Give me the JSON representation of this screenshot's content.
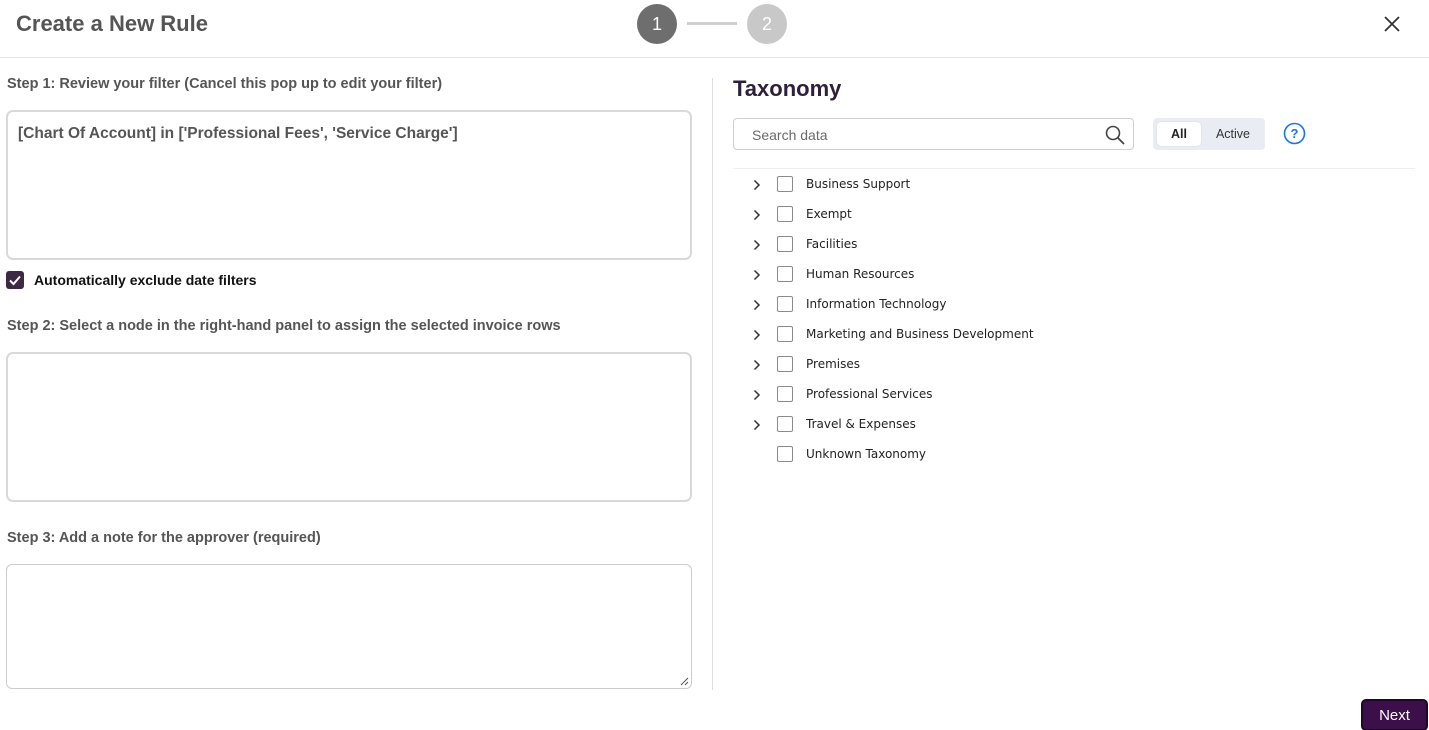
{
  "header": {
    "title": "Create a New Rule",
    "steps": [
      "1",
      "2"
    ],
    "current_step": 1
  },
  "step1": {
    "label": "Step 1: Review your filter (Cancel this pop up to edit your filter)",
    "filter_text": "[Chart Of Account] in ['Professional Fees', 'Service Charge']",
    "exclude_label": "Automatically exclude date filters",
    "exclude_checked": true
  },
  "step2": {
    "label": "Step 2: Select a node in the right-hand panel to assign the selected invoice rows",
    "value": ""
  },
  "step3": {
    "label": "Step 3: Add a note for the approver (required)",
    "value": ""
  },
  "taxonomy": {
    "title": "Taxonomy",
    "search_placeholder": "Search data",
    "toggle_all": "All",
    "toggle_active": "Active",
    "selected_toggle": "All",
    "items": [
      {
        "label": "Business Support",
        "expandable": true
      },
      {
        "label": "Exempt",
        "expandable": true
      },
      {
        "label": "Facilities",
        "expandable": true
      },
      {
        "label": "Human Resources",
        "expandable": true
      },
      {
        "label": "Information Technology",
        "expandable": true
      },
      {
        "label": "Marketing and Business Development",
        "expandable": true
      },
      {
        "label": "Premises",
        "expandable": true
      },
      {
        "label": "Professional Services",
        "expandable": true
      },
      {
        "label": "Travel & Expenses",
        "expandable": true
      },
      {
        "label": "Unknown Taxonomy",
        "expandable": false
      }
    ]
  },
  "footer": {
    "next_label": "Next"
  },
  "colors": {
    "primary": "#3c0f4a",
    "checkbox": "#3c2a45",
    "help": "#1a73e8",
    "step_active": "#6e6e6e",
    "step_inactive": "#c8c8c8"
  }
}
